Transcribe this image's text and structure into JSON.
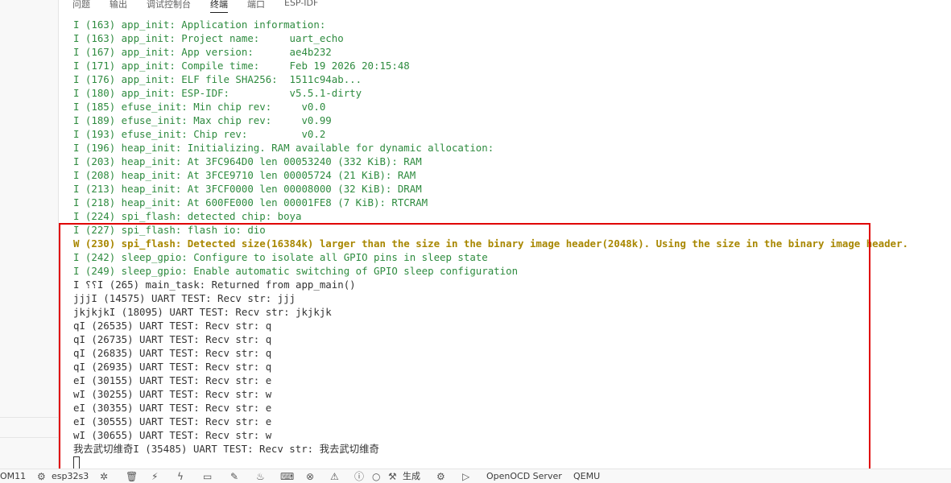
{
  "panel": {
    "tabs": [
      {
        "label": "问题"
      },
      {
        "label": "输出"
      },
      {
        "label": "调试控制台"
      },
      {
        "label": "终端"
      },
      {
        "label": "端口"
      },
      {
        "label": "ESP-IDF"
      }
    ],
    "active_tab": "终端"
  },
  "terminal": {
    "lines": [
      {
        "kind": "info",
        "text": "I (163) app_init: Application information:"
      },
      {
        "kind": "info",
        "text": "I (163) app_init: Project name:     uart_echo"
      },
      {
        "kind": "info",
        "text": "I (167) app_init: App version:      ae4b232"
      },
      {
        "kind": "info",
        "text": "I (171) app_init: Compile time:     Feb 19 2026 20:15:48"
      },
      {
        "kind": "info",
        "text": "I (176) app_init: ELF file SHA256:  1511c94ab..."
      },
      {
        "kind": "info",
        "text": "I (180) app_init: ESP-IDF:          v5.5.1-dirty"
      },
      {
        "kind": "info",
        "text": "I (185) efuse_init: Min chip rev:     v0.0"
      },
      {
        "kind": "info",
        "text": "I (189) efuse_init: Max chip rev:     v0.99"
      },
      {
        "kind": "info",
        "text": "I (193) efuse_init: Chip rev:         v0.2"
      },
      {
        "kind": "info",
        "text": "I (196) heap_init: Initializing. RAM available for dynamic allocation:"
      },
      {
        "kind": "info",
        "text": "I (203) heap_init: At 3FC964D0 len 00053240 (332 KiB): RAM"
      },
      {
        "kind": "info",
        "text": "I (208) heap_init: At 3FCE9710 len 00005724 (21 KiB): RAM"
      },
      {
        "kind": "info",
        "text": "I (213) heap_init: At 3FCF0000 len 00008000 (32 KiB): DRAM"
      },
      {
        "kind": "info",
        "text": "I (218) heap_init: At 600FE000 len 00001FE8 (7 KiB): RTCRAM"
      },
      {
        "kind": "info",
        "text": "I (224) spi_flash: detected chip: boya"
      },
      {
        "kind": "info",
        "text": "I (227) spi_flash: flash io: dio"
      },
      {
        "kind": "warn",
        "text": "W (230) spi_flash: Detected size(16384k) larger than the size in the binary image header(2048k). Using the size in the binary image header."
      },
      {
        "kind": "info",
        "text": "I (242) sleep_gpio: Configure to isolate all GPIO pins in sleep state"
      },
      {
        "kind": "info",
        "text": "I (249) sleep_gpio: Enable automatic switching of GPIO sleep configuration"
      },
      {
        "kind": "plain",
        "text": "I ⸮⸮I (265) main_task: Returned from app_main()"
      },
      {
        "kind": "plain",
        "text": "jjjI (14575) UART TEST: Recv str: jjj"
      },
      {
        "kind": "plain",
        "text": "jkjkjkI (18095) UART TEST: Recv str: jkjkjk"
      },
      {
        "kind": "plain",
        "text": "qI (26535) UART TEST: Recv str: q"
      },
      {
        "kind": "plain",
        "text": "qI (26735) UART TEST: Recv str: q"
      },
      {
        "kind": "plain",
        "text": "qI (26835) UART TEST: Recv str: q"
      },
      {
        "kind": "plain",
        "text": "qI (26935) UART TEST: Recv str: q"
      },
      {
        "kind": "plain",
        "text": "eI (30155) UART TEST: Recv str: e"
      },
      {
        "kind": "plain",
        "text": "wI (30255) UART TEST: Recv str: w"
      },
      {
        "kind": "plain",
        "text": "eI (30355) UART TEST: Recv str: e"
      },
      {
        "kind": "plain",
        "text": "eI (30555) UART TEST: Recv str: e"
      },
      {
        "kind": "plain",
        "text": "wI (30655) UART TEST: Recv str: w"
      },
      {
        "kind": "plain",
        "text": "我去武切维奇I (35485) UART TEST: Recv str: 我去武切维奇"
      }
    ]
  },
  "statusbar": {
    "port_label": "OM11",
    "target_label": "esp32s3",
    "build_label": "生成",
    "openocd_label": "OpenOCD Server",
    "qemu_label": "QEMU"
  }
}
